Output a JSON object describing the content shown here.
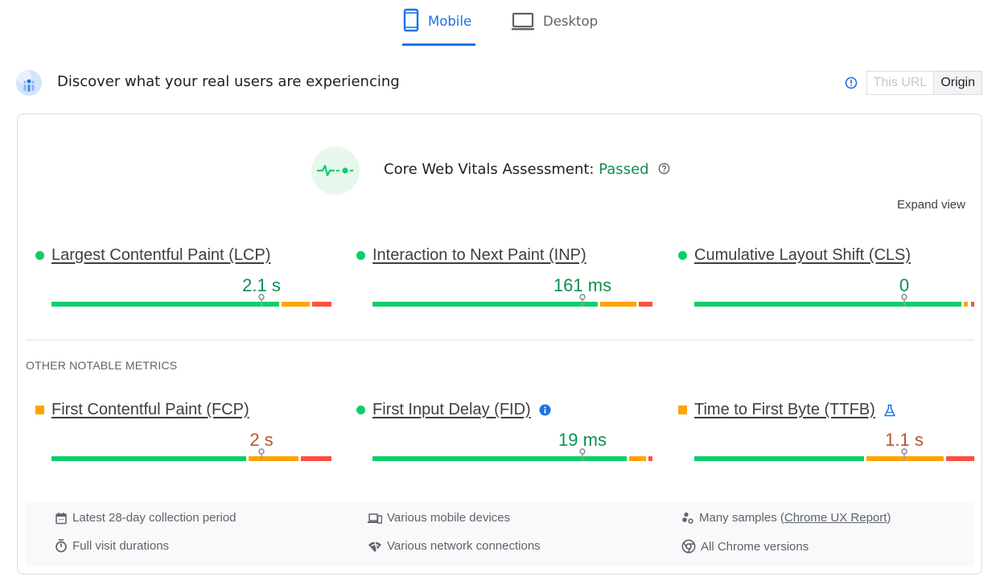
{
  "tabs": [
    {
      "label": "Mobile",
      "icon": "smartphone-icon",
      "active": true
    },
    {
      "label": "Desktop",
      "icon": "laptop-icon",
      "active": false
    }
  ],
  "discover": {
    "title": "Discover what your real users are experiencing",
    "toggle": {
      "options": [
        "This URL",
        "Origin"
      ],
      "selected": "Origin"
    }
  },
  "assessment": {
    "label": "Core Web Vitals Assessment:",
    "status": "Passed",
    "expand_label": "Expand view"
  },
  "core_metrics": [
    {
      "name": "Largest Contentful Paint (LCP)",
      "value": "2.1 s",
      "rating": "good",
      "distribution": {
        "good": 0.82,
        "needs_improvement": 0.1,
        "poor": 0.07
      },
      "marker_percentile": 0.75
    },
    {
      "name": "Interaction to Next Paint (INP)",
      "value": "161 ms",
      "rating": "good",
      "distribution": {
        "good": 0.81,
        "needs_improvement": 0.13,
        "poor": 0.05
      },
      "marker_percentile": 0.75
    },
    {
      "name": "Cumulative Layout Shift (CLS)",
      "value": "0",
      "rating": "good",
      "distribution": {
        "good": 0.96,
        "needs_improvement": 0.015,
        "poor": 0.013
      },
      "marker_percentile": 0.75
    }
  ],
  "other_label": "OTHER NOTABLE METRICS",
  "other_metrics": [
    {
      "name": "First Contentful Paint (FCP)",
      "value": "2 s",
      "rating": "average",
      "distribution": {
        "good": 0.7,
        "needs_improvement": 0.18,
        "poor": 0.11
      },
      "marker_percentile": 0.75
    },
    {
      "name": "First Input Delay (FID)",
      "value": "19 ms",
      "rating": "good",
      "extra_icon": "info-icon",
      "distribution": {
        "good": 0.92,
        "needs_improvement": 0.06,
        "poor": 0.015
      },
      "marker_percentile": 0.75
    },
    {
      "name": "Time to First Byte (TTFB)",
      "value": "1.1 s",
      "rating": "average",
      "extra_icon": "flask-icon",
      "distribution": {
        "good": 0.61,
        "needs_improvement": 0.28,
        "poor": 0.1
      },
      "marker_percentile": 0.75
    }
  ],
  "footer": {
    "items": [
      {
        "icon": "calendar-icon",
        "text": "Latest 28-day collection period"
      },
      {
        "icon": "devices-icon",
        "text": "Various mobile devices"
      },
      {
        "icon": "samples-icon",
        "text": "Many samples (",
        "link": "Chrome UX Report",
        "suffix": ")"
      },
      {
        "icon": "stopwatch-icon",
        "text": "Full visit durations"
      },
      {
        "icon": "network-icon",
        "text": "Various network connections"
      },
      {
        "icon": "chrome-icon",
        "text": "All Chrome versions"
      }
    ]
  },
  "colors": {
    "accent": "#1a73e8",
    "good": "#0cce6b",
    "good_text": "#0d904f",
    "average": "#ffa400",
    "average_text": "#b3562e",
    "poor": "#ff4e42"
  }
}
